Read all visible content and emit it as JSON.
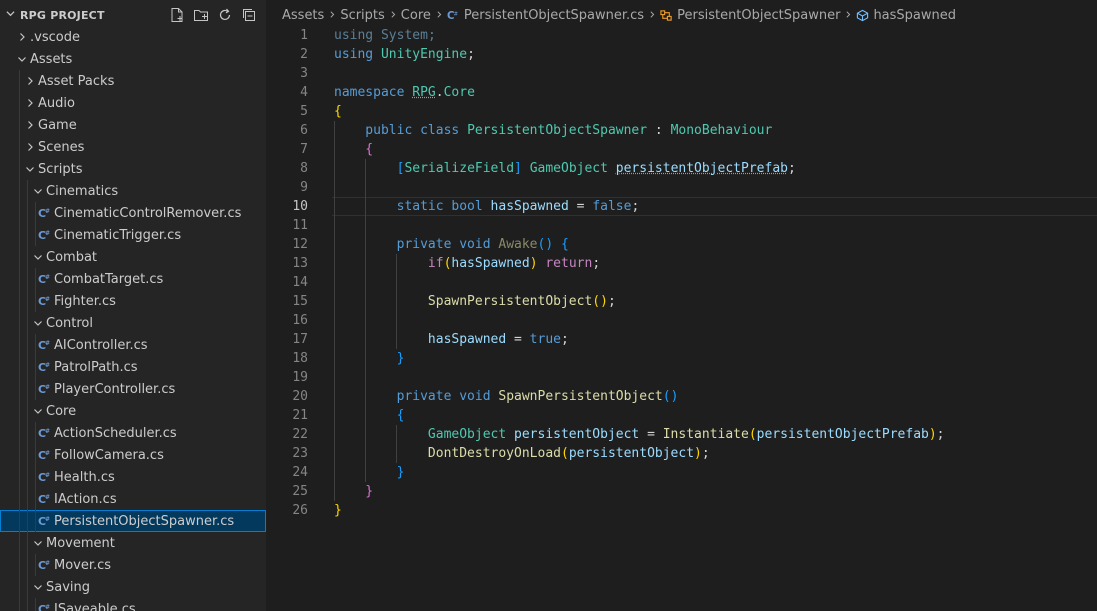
{
  "explorer": {
    "title": "RPG PROJECT",
    "actions": [
      {
        "icon": "new-file-icon"
      },
      {
        "icon": "new-folder-icon"
      },
      {
        "icon": "refresh-icon"
      },
      {
        "icon": "collapse-all-icon"
      }
    ],
    "items": [
      {
        "label": ".vscode",
        "depth": 1,
        "kind": "folder",
        "expanded": false
      },
      {
        "label": "Assets",
        "depth": 1,
        "kind": "folder",
        "expanded": true
      },
      {
        "label": "Asset Packs",
        "depth": 2,
        "kind": "folder",
        "expanded": false
      },
      {
        "label": "Audio",
        "depth": 2,
        "kind": "folder",
        "expanded": false
      },
      {
        "label": "Game",
        "depth": 2,
        "kind": "folder",
        "expanded": false
      },
      {
        "label": "Scenes",
        "depth": 2,
        "kind": "folder",
        "expanded": false
      },
      {
        "label": "Scripts",
        "depth": 2,
        "kind": "folder",
        "expanded": true
      },
      {
        "label": "Cinematics",
        "depth": 3,
        "kind": "folder",
        "expanded": true
      },
      {
        "label": "CinematicControlRemover.cs",
        "depth": 4,
        "kind": "file"
      },
      {
        "label": "CinematicTrigger.cs",
        "depth": 4,
        "kind": "file"
      },
      {
        "label": "Combat",
        "depth": 3,
        "kind": "folder",
        "expanded": true
      },
      {
        "label": "CombatTarget.cs",
        "depth": 4,
        "kind": "file"
      },
      {
        "label": "Fighter.cs",
        "depth": 4,
        "kind": "file"
      },
      {
        "label": "Control",
        "depth": 3,
        "kind": "folder",
        "expanded": true
      },
      {
        "label": "AIController.cs",
        "depth": 4,
        "kind": "file"
      },
      {
        "label": "PatrolPath.cs",
        "depth": 4,
        "kind": "file"
      },
      {
        "label": "PlayerController.cs",
        "depth": 4,
        "kind": "file"
      },
      {
        "label": "Core",
        "depth": 3,
        "kind": "folder",
        "expanded": true
      },
      {
        "label": "ActionScheduler.cs",
        "depth": 4,
        "kind": "file"
      },
      {
        "label": "FollowCamera.cs",
        "depth": 4,
        "kind": "file"
      },
      {
        "label": "Health.cs",
        "depth": 4,
        "kind": "file"
      },
      {
        "label": "IAction.cs",
        "depth": 4,
        "kind": "file"
      },
      {
        "label": "PersistentObjectSpawner.cs",
        "depth": 4,
        "kind": "file",
        "selected": true
      },
      {
        "label": "Movement",
        "depth": 3,
        "kind": "folder",
        "expanded": true
      },
      {
        "label": "Mover.cs",
        "depth": 4,
        "kind": "file"
      },
      {
        "label": "Saving",
        "depth": 3,
        "kind": "folder",
        "expanded": true
      },
      {
        "label": "ISaveable.cs",
        "depth": 4,
        "kind": "file"
      }
    ]
  },
  "breadcrumb": [
    {
      "label": "Assets",
      "icon": ""
    },
    {
      "label": "Scripts",
      "icon": ""
    },
    {
      "label": "Core",
      "icon": ""
    },
    {
      "label": "PersistentObjectSpawner.cs",
      "icon": "csharp-file-icon"
    },
    {
      "label": "PersistentObjectSpawner",
      "icon": "class-icon"
    },
    {
      "label": "hasSpawned",
      "icon": "field-icon"
    }
  ],
  "editor": {
    "current_line": 10,
    "lines": [
      [
        [
          "using ",
          "dim"
        ],
        [
          "System",
          "dim"
        ],
        [
          ";",
          "dim"
        ]
      ],
      [
        [
          "using ",
          "kw"
        ],
        [
          "UnityEngine",
          "ty"
        ],
        [
          ";",
          "pl"
        ]
      ],
      [],
      [
        [
          "namespace ",
          "kw"
        ],
        [
          "RPG",
          "ty sq"
        ],
        [
          ".",
          "pl"
        ],
        [
          "Core",
          "ty"
        ]
      ],
      [
        [
          "{",
          "b1"
        ]
      ],
      [
        [
          "    public ",
          "kw"
        ],
        [
          "class ",
          "kw"
        ],
        [
          "PersistentObjectSpawner",
          "ty"
        ],
        [
          " : ",
          "pl"
        ],
        [
          "MonoBehaviour",
          "ty"
        ]
      ],
      [
        [
          "    {",
          "b2"
        ]
      ],
      [
        [
          "        [",
          "b3"
        ],
        [
          "SerializeField",
          "ty"
        ],
        [
          "] ",
          "b3"
        ],
        [
          "GameObject ",
          "ty"
        ],
        [
          "persistentObjectPrefab",
          "id sq"
        ],
        [
          ";",
          "pl"
        ]
      ],
      [],
      [
        [
          "        static ",
          "kw"
        ],
        [
          "bool ",
          "kw"
        ],
        [
          "hasSpawned",
          "id"
        ],
        [
          " = ",
          "pl"
        ],
        [
          "false",
          "kw"
        ],
        [
          ";",
          "pl"
        ]
      ],
      [],
      [
        [
          "        private ",
          "kw"
        ],
        [
          "void ",
          "kw"
        ],
        [
          "Awake",
          "dimfn"
        ],
        [
          "()",
          "b3"
        ],
        [
          " {",
          "b3"
        ]
      ],
      [
        [
          "            if",
          "ctl"
        ],
        [
          "(",
          "b1"
        ],
        [
          "hasSpawned",
          "id"
        ],
        [
          ") ",
          "b1"
        ],
        [
          "return",
          "ctl"
        ],
        [
          ";",
          "pl"
        ]
      ],
      [],
      [
        [
          "            SpawnPersistentObject",
          "fn"
        ],
        [
          "()",
          "b1"
        ],
        [
          ";",
          "pl"
        ]
      ],
      [],
      [
        [
          "            hasSpawned",
          "id"
        ],
        [
          " = ",
          "pl"
        ],
        [
          "true",
          "kw"
        ],
        [
          ";",
          "pl"
        ]
      ],
      [
        [
          "        }",
          "b3"
        ]
      ],
      [],
      [
        [
          "        private ",
          "kw"
        ],
        [
          "void ",
          "kw"
        ],
        [
          "SpawnPersistentObject",
          "fn"
        ],
        [
          "()",
          "b3"
        ]
      ],
      [
        [
          "        {",
          "b3"
        ]
      ],
      [
        [
          "            GameObject ",
          "ty"
        ],
        [
          "persistentObject",
          "id"
        ],
        [
          " = ",
          "pl"
        ],
        [
          "Instantiate",
          "fn"
        ],
        [
          "(",
          "b1"
        ],
        [
          "persistentObjectPrefab",
          "id"
        ],
        [
          ")",
          "b1"
        ],
        [
          ";",
          "pl"
        ]
      ],
      [
        [
          "            DontDestroyOnLoad",
          "fn"
        ],
        [
          "(",
          "b1"
        ],
        [
          "persistentObject",
          "id"
        ],
        [
          ")",
          "b1"
        ],
        [
          ";",
          "pl"
        ]
      ],
      [
        [
          "        }",
          "b3"
        ]
      ],
      [
        [
          "    }",
          "b2"
        ]
      ],
      [
        [
          "}",
          "b1"
        ]
      ]
    ]
  },
  "colors": {
    "background": "#1e1e1e",
    "sidebar": "#252526",
    "selection": "#04395e",
    "selection_border": "#007fd4",
    "keyword": "#569cd6",
    "type": "#4ec9b0",
    "function": "#dcdcaa",
    "variable": "#9cdcfe"
  }
}
